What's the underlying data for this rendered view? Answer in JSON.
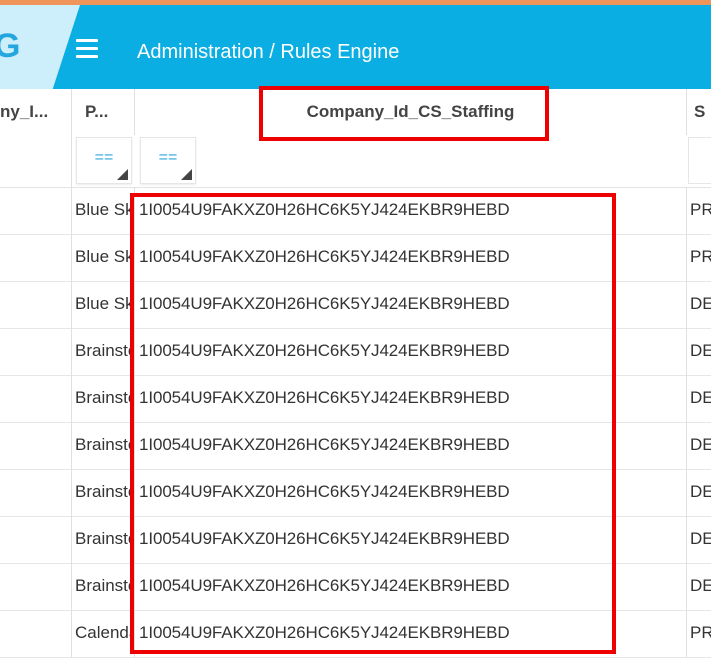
{
  "header": {
    "logo_letter": "G",
    "title": "Administration / Rules Engine"
  },
  "columns": [
    {
      "label": "ny_I..."
    },
    {
      "label": "P..."
    },
    {
      "label": "Company_Id_CS_Staffing"
    },
    {
      "label": "S"
    }
  ],
  "filters": {
    "operator_1": "==",
    "operator_2": "=="
  },
  "rows": [
    {
      "c1": "Blue Sky",
      "c2": "1I0054U9FAKXZ0H26HC6K5YJ424EKBR9HEBD",
      "c3": "PR"
    },
    {
      "c1": "Blue Sky",
      "c2": "1I0054U9FAKXZ0H26HC6K5YJ424EKBR9HEBD",
      "c3": "PR"
    },
    {
      "c1": "Blue Sky",
      "c2": "1I0054U9FAKXZ0H26HC6K5YJ424EKBR9HEBD",
      "c3": "DE"
    },
    {
      "c1": "Brainstorm",
      "c2": "1I0054U9FAKXZ0H26HC6K5YJ424EKBR9HEBD",
      "c3": "DE"
    },
    {
      "c1": "Brainstorm",
      "c2": "1I0054U9FAKXZ0H26HC6K5YJ424EKBR9HEBD",
      "c3": "DE"
    },
    {
      "c1": "Brainstorm",
      "c2": "1I0054U9FAKXZ0H26HC6K5YJ424EKBR9HEBD",
      "c3": "DE"
    },
    {
      "c1": "Brainstorm",
      "c2": "1I0054U9FAKXZ0H26HC6K5YJ424EKBR9HEBD",
      "c3": "DE"
    },
    {
      "c1": "Brainstorm",
      "c2": "1I0054U9FAKXZ0H26HC6K5YJ424EKBR9HEBD",
      "c3": "DE"
    },
    {
      "c1": "Brainstorm",
      "c2": "1I0054U9FAKXZ0H26HC6K5YJ424EKBR9HEBD",
      "c3": "DE"
    },
    {
      "c1": "Calendar",
      "c2": "1I0054U9FAKXZ0H26HC6K5YJ424EKBR9HEBD",
      "c3": "PR"
    }
  ],
  "colors": {
    "header_bg": "#0aaee3",
    "top_strip": "#f0955a",
    "highlight": "#ee0000",
    "filter_operator": "#2aa6dd"
  }
}
